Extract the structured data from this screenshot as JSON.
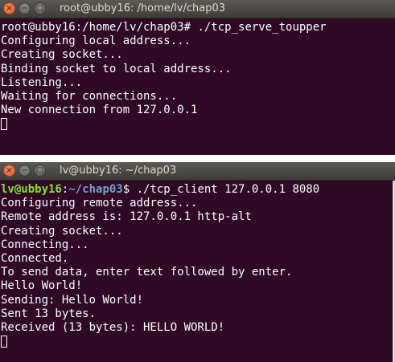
{
  "window1": {
    "title": "root@ubby16: /home/lv/chap03",
    "close_glyph": "×",
    "min_glyph": "−",
    "max_glyph": "□",
    "prompt": "root@ubby16:/home/lv/chap03# ",
    "command": "./tcp_serve_toupper",
    "output": [
      "Configuring local address...",
      "Creating socket...",
      "Binding socket to local address...",
      "Listening...",
      "Waiting for connections...",
      "New connection from 127.0.0.1"
    ]
  },
  "window2": {
    "title": "lv@ubby16: ~/chap03",
    "close_glyph": "×",
    "min_glyph": "−",
    "max_glyph": "□",
    "prompt_user": "lv@ubby16",
    "prompt_sep": ":",
    "prompt_path": "~/chap03",
    "prompt_end": "$ ",
    "command": "./tcp_client 127.0.0.1 8080",
    "output": [
      "Configuring remote address...",
      "Remote address is: 127.0.0.1 http-alt",
      "Creating socket...",
      "Connecting...",
      "Connected.",
      "To send data, enter text followed by enter.",
      "Hello World!",
      "Sending: Hello World!",
      "Sent 13 bytes.",
      "Received (13 bytes): HELLO WORLD!"
    ]
  },
  "colors": {
    "terminal_bg": "#300a24",
    "prompt_user": "#8ae234",
    "prompt_path": "#729fcf",
    "close_button": "#e05a2a"
  }
}
